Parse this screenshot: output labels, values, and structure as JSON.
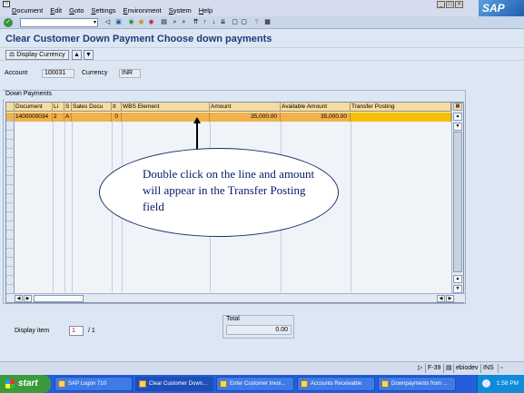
{
  "menu": {
    "items": [
      "Document",
      "Edit",
      "Goto",
      "Settings",
      "Environment",
      "System",
      "Help"
    ]
  },
  "brand": {
    "logo": "SAP"
  },
  "window": {
    "title": "Clear Customer Down Payment Choose down payments"
  },
  "app_toolbar": {
    "display_currency": "Display Currency"
  },
  "header": {
    "account_label": "Account",
    "account_value": "100031",
    "currency_label": "Currency",
    "currency_value": "INR"
  },
  "group": {
    "title": "Down Payments"
  },
  "table": {
    "columns": [
      "Document",
      "Li",
      "S",
      "Sales Docu",
      "It",
      "WBS Element",
      "Amount",
      "Available Amount",
      "Transfer Posting"
    ],
    "row": {
      "document": "1400000034",
      "li": "2",
      "s": "A",
      "sales_doc": "",
      "item": "0",
      "wbs": "",
      "amount": "35,000.00",
      "available_amount": "35,000.00",
      "transfer_posting": ""
    }
  },
  "callout": {
    "text": "Double click on the line and amount will appear in the Transfer Posting field"
  },
  "footer": {
    "display_item_label": "Display item",
    "display_item_value": "1",
    "display_item_total": "/ 1",
    "total_label": "Total",
    "total_value": "0.00"
  },
  "status": {
    "transaction": "F-39",
    "server": "ebiodev",
    "mode": "INS"
  },
  "taskbar": {
    "start": "start",
    "tasks": [
      "SAP Logon 710",
      "Clear Customer Down...",
      "Enter Customer Invoi...",
      "Accounts Receivable",
      "Downpayments from ..."
    ],
    "clock": "1:58 PM"
  },
  "colors": {
    "selected_row": "#f0b24a",
    "table_header": "#f4dca2",
    "title": "#1b3c7a",
    "taskbar": "#245edb"
  }
}
